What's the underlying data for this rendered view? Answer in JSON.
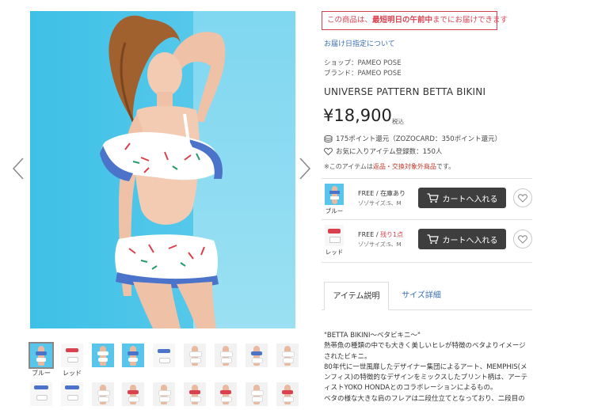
{
  "gallery": {
    "prev_icon": "chevron-left-icon",
    "next_icon": "chevron-right-icon",
    "thumb_labels": [
      "ブルー",
      "レッド"
    ]
  },
  "notice": {
    "prefix": "この商品は、",
    "bold": "最短明日の午前中",
    "suffix": "までにお届けできます"
  },
  "delivery_link": "お届け日指定について",
  "shop_line": "ショップ：PAMEO POSE",
  "brand_line": "ブランド：PAMEO POSE",
  "product_name": "UNIVERSE PATTERN BETTA BIKINI",
  "price": "¥18,900",
  "tax_label": "税込",
  "points_text": "175ポイント還元（ZOZOCARD：350ポイント還元）",
  "favorites_text": "お気に入りアイテム登録数：150人",
  "warning": {
    "prefix": "※このアイテムは",
    "red": "返品・交換対象外商品",
    "suffix": "です。"
  },
  "variants": [
    {
      "label": "ブルー",
      "stock_prefix": "FREE / ",
      "stock_status": "在庫あり",
      "sizes": "ゾゾサイズ:S、M",
      "cart_label": "カートへ入れる"
    },
    {
      "label": "レッド",
      "stock_prefix": "FREE / ",
      "stock_status": "残り1点",
      "sizes": "ゾゾサイズ:S、M",
      "cart_label": "カートへ入れる"
    }
  ],
  "tabs": {
    "description": "アイテム説明",
    "size": "サイズ詳細"
  },
  "description_lines": [
    "\"BETTA BIKINI～ベタビキニ～\"",
    "熱帯魚の種類の中でも大きく美しいヒレが特徴のベタよりイメージされたビキニ。",
    "80年代に一世風靡したデザイナー集団によるアート、MEMPHIS(メンフィス)の特徴的なデザインをミックスしたプリント柄は、アーティストYOKO HONDAとのコラボレーションによるもの。",
    "ベタの様な大きな肩のフレアは二段仕立てとなっており、二段目の"
  ],
  "colors": {
    "accent_red": "#d9414f",
    "link_blue": "#3b6fb6",
    "cart_button": "#3e3e3e",
    "photo_blue": "#3ec0e6"
  }
}
